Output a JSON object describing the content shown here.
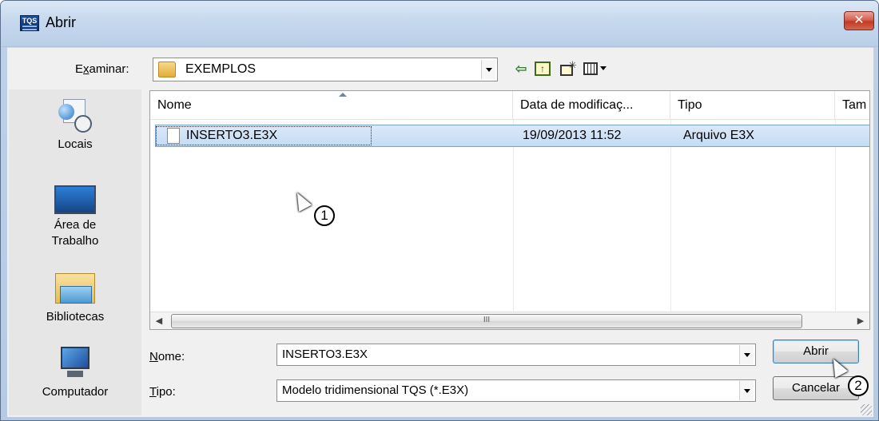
{
  "window": {
    "title": "Abrir",
    "app_icon_text": "TQS",
    "close_label": "✕"
  },
  "lookin": {
    "label_prefix": "E",
    "label_underlined": "x",
    "label_rest": "aminar:",
    "value": "EXEMPLOS"
  },
  "toolbar": {
    "back_icon": "back-arrow-icon",
    "up_icon": "up-folder-icon",
    "new_icon": "new-folder-icon",
    "view_icon": "view-menu-icon"
  },
  "places": [
    {
      "label": "Locais",
      "icon": "recent-places-icon"
    },
    {
      "label": "Área de Trabalho",
      "icon": "desktop-icon"
    },
    {
      "label": "Bibliotecas",
      "icon": "libraries-icon"
    },
    {
      "label": "Computador",
      "icon": "computer-icon"
    }
  ],
  "columns": [
    "Nome",
    "Data de modificaç...",
    "Tipo",
    "Tam"
  ],
  "files": [
    {
      "name": "INSERTO3.E3X",
      "modified": "19/09/2013 11:52",
      "type": "Arquivo E3X",
      "selected": true
    }
  ],
  "scrollbar": {
    "thumb_grip": "III"
  },
  "filename": {
    "label_underlined": "N",
    "label_rest": "ome:",
    "value": "INSERTO3.E3X"
  },
  "filetype": {
    "label_underlined": "T",
    "label_rest": "ipo:",
    "value": "Modelo tridimensional TQS (*.E3X)"
  },
  "buttons": {
    "open": "Abrir",
    "cancel": "Cancelar"
  },
  "markers": [
    "1",
    "2"
  ]
}
